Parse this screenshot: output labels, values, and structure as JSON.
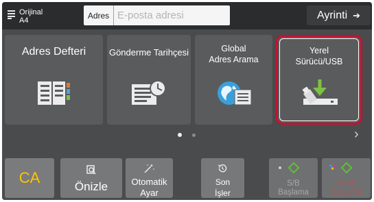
{
  "header": {
    "original_label": "Orijinal",
    "original_size": "A4",
    "address_label": "Adres",
    "address_placeholder": "E-posta adresi",
    "next_label": "Ayrinti",
    "next_arrow": "➔"
  },
  "tiles": [
    {
      "label": "Adres Defteri",
      "icon": "address-book-icon"
    },
    {
      "label": "Gönderme Tarihçesi",
      "icon": "send-history-icon"
    },
    {
      "label_line1": "Global",
      "label_line2": "Adres Arama",
      "icon": "global-search-icon"
    },
    {
      "label_line1": "Yerel",
      "label_line2": "Sürücü/USB",
      "icon": "usb-drive-icon",
      "selected": true
    }
  ],
  "pager": {
    "pages": 2,
    "current": 1,
    "next_glyph": "›"
  },
  "bottom": {
    "ca_label": "CA",
    "preview_label": "Önizle",
    "auto_line1": "Otomatik",
    "auto_line2": "Ayar",
    "jobs_line1": "Son",
    "jobs_line2": "İşler",
    "bw_line1": "S/B",
    "bw_line2": "Başlama",
    "color_line1": "Renk",
    "color_line2": "Başlama"
  },
  "colors": {
    "accent_highlight": "#c8102e",
    "ca_text": "#ffc400",
    "start_diamond": "#5fbf3a"
  }
}
